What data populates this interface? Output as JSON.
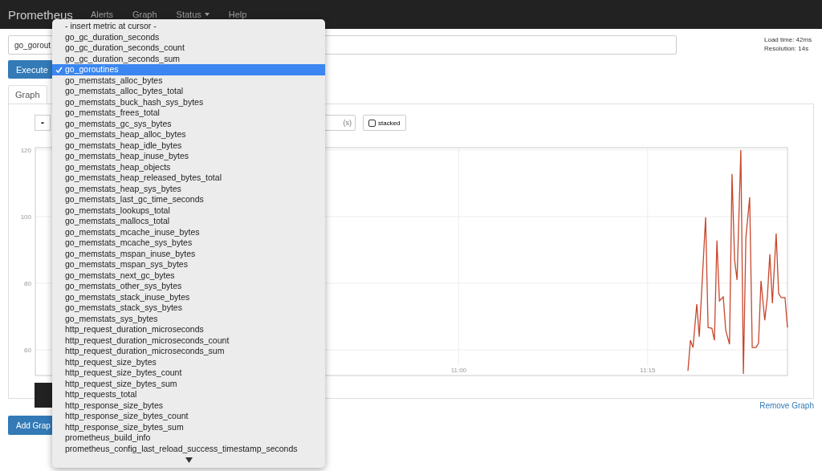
{
  "navbar": {
    "brand": "Prometheus",
    "links": [
      {
        "label": "Alerts",
        "dropdown": false
      },
      {
        "label": "Graph",
        "dropdown": false
      },
      {
        "label": "Status",
        "dropdown": true
      },
      {
        "label": "Help",
        "dropdown": false
      }
    ]
  },
  "expression": {
    "value": "go_gorout"
  },
  "stats": [
    "Load time: 42ms",
    "Resolution: 14s"
  ],
  "execute_button": "Execute",
  "tabs": [
    {
      "label": "Graph",
      "selected": true
    }
  ],
  "graph_controls": {
    "range_decrease": "-",
    "resolution_field": {
      "placeholder": "(s)"
    },
    "stacked": {
      "label": "stacked",
      "checked": false
    }
  },
  "chart_data": {
    "type": "line",
    "grid": true,
    "xlim": [
      626.4,
      686.1
    ],
    "ylim": [
      52.3,
      120.7
    ],
    "yticks": [
      60,
      80,
      100,
      120
    ],
    "xticks": [
      {
        "value": 660,
        "label": "11:00"
      },
      {
        "value": 675,
        "label": "11:15"
      }
    ],
    "x": [
      678.2,
      678.4,
      678.6,
      678.9,
      679.1,
      679.6,
      679.8,
      680.1,
      680.3,
      680.5,
      680.7,
      681.0,
      681.2,
      681.5,
      681.7,
      681.9,
      682.1,
      682.4,
      682.6,
      682.8,
      683.1,
      683.3,
      683.6,
      683.8,
      684.0,
      684.3,
      684.5,
      684.7,
      684.9,
      685.2,
      685.4,
      685.6,
      685.9,
      686.1
    ],
    "series": [
      {
        "color": "#c8472d",
        "values": [
          53.7,
          62.9,
          60.7,
          73.7,
          63.9,
          99.8,
          66.7,
          66.5,
          62.9,
          92.8,
          74.7,
          75.9,
          65.8,
          61.7,
          112.8,
          87.0,
          81.0,
          120,
          52.8,
          93.7,
          105.8,
          60.7,
          60.7,
          62,
          80.7,
          68.9,
          75.7,
          88.7,
          74,
          94.9,
          76.9,
          75.7,
          75.7,
          66.7
        ]
      }
    ]
  },
  "remove_graph": "Remove Graph",
  "add_graph": "Add Grap",
  "metric_menu": {
    "items": [
      {
        "label": "- insert metric at cursor -",
        "selected": false
      },
      {
        "label": "go_gc_duration_seconds",
        "selected": false
      },
      {
        "label": "go_gc_duration_seconds_count",
        "selected": false
      },
      {
        "label": "go_gc_duration_seconds_sum",
        "selected": false
      },
      {
        "label": "go_goroutines",
        "selected": true
      },
      {
        "label": "go_memstats_alloc_bytes",
        "selected": false
      },
      {
        "label": "go_memstats_alloc_bytes_total",
        "selected": false
      },
      {
        "label": "go_memstats_buck_hash_sys_bytes",
        "selected": false
      },
      {
        "label": "go_memstats_frees_total",
        "selected": false
      },
      {
        "label": "go_memstats_gc_sys_bytes",
        "selected": false
      },
      {
        "label": "go_memstats_heap_alloc_bytes",
        "selected": false
      },
      {
        "label": "go_memstats_heap_idle_bytes",
        "selected": false
      },
      {
        "label": "go_memstats_heap_inuse_bytes",
        "selected": false
      },
      {
        "label": "go_memstats_heap_objects",
        "selected": false
      },
      {
        "label": "go_memstats_heap_released_bytes_total",
        "selected": false
      },
      {
        "label": "go_memstats_heap_sys_bytes",
        "selected": false
      },
      {
        "label": "go_memstats_last_gc_time_seconds",
        "selected": false
      },
      {
        "label": "go_memstats_lookups_total",
        "selected": false
      },
      {
        "label": "go_memstats_mallocs_total",
        "selected": false
      },
      {
        "label": "go_memstats_mcache_inuse_bytes",
        "selected": false
      },
      {
        "label": "go_memstats_mcache_sys_bytes",
        "selected": false
      },
      {
        "label": "go_memstats_mspan_inuse_bytes",
        "selected": false
      },
      {
        "label": "go_memstats_mspan_sys_bytes",
        "selected": false
      },
      {
        "label": "go_memstats_next_gc_bytes",
        "selected": false
      },
      {
        "label": "go_memstats_other_sys_bytes",
        "selected": false
      },
      {
        "label": "go_memstats_stack_inuse_bytes",
        "selected": false
      },
      {
        "label": "go_memstats_stack_sys_bytes",
        "selected": false
      },
      {
        "label": "go_memstats_sys_bytes",
        "selected": false
      },
      {
        "label": "http_request_duration_microseconds",
        "selected": false
      },
      {
        "label": "http_request_duration_microseconds_count",
        "selected": false
      },
      {
        "label": "http_request_duration_microseconds_sum",
        "selected": false
      },
      {
        "label": "http_request_size_bytes",
        "selected": false
      },
      {
        "label": "http_request_size_bytes_count",
        "selected": false
      },
      {
        "label": "http_request_size_bytes_sum",
        "selected": false
      },
      {
        "label": "http_requests_total",
        "selected": false
      },
      {
        "label": "http_response_size_bytes",
        "selected": false
      },
      {
        "label": "http_response_size_bytes_count",
        "selected": false
      },
      {
        "label": "http_response_size_bytes_sum",
        "selected": false
      },
      {
        "label": "prometheus_build_info",
        "selected": false
      },
      {
        "label": "prometheus_config_last_reload_success_timestamp_seconds",
        "selected": false
      }
    ]
  }
}
